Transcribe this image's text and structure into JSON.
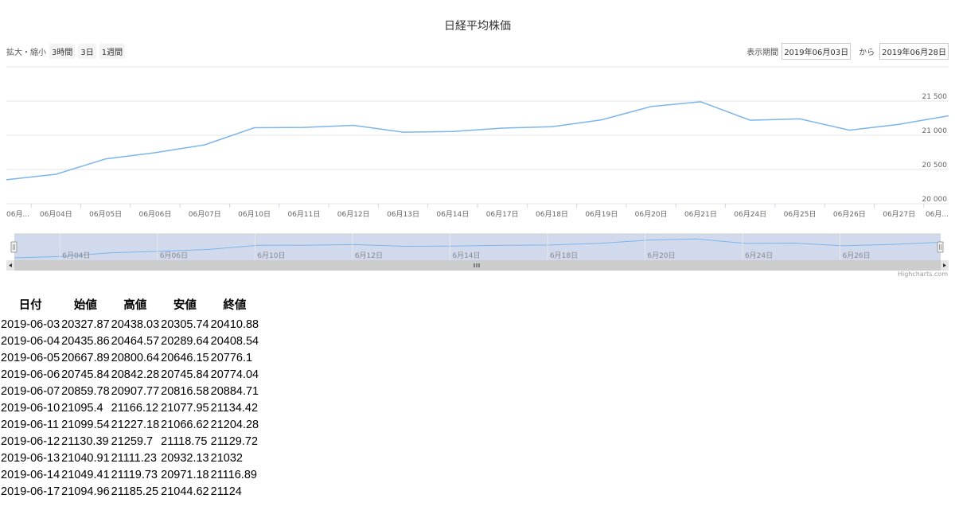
{
  "title": "日経平均株価",
  "zoom": {
    "label": "拡大・縮小",
    "buttons": [
      "3時間",
      "3日",
      "1週間"
    ]
  },
  "range": {
    "label": "表示期間",
    "from": "2019年06月03日",
    "to_label": "から",
    "to": "2019年06月28日"
  },
  "credit": "Highcharts.com",
  "chart_data": {
    "type": "line",
    "x": [
      "06月...",
      "06月04日",
      "06月05日",
      "06月06日",
      "06月07日",
      "06月10日",
      "06月11日",
      "06月12日",
      "06月13日",
      "06月14日",
      "06月17日",
      "06月18日",
      "06月19日",
      "06月20日",
      "06月21日",
      "06月24日",
      "06月25日",
      "06月26日",
      "06月27日",
      "06月..."
    ],
    "values": [
      20350,
      20430,
      20655,
      20745,
      20860,
      21110,
      21115,
      21145,
      21045,
      21055,
      21105,
      21125,
      21225,
      21420,
      21490,
      21220,
      21240,
      21075,
      21160,
      21285
    ],
    "y_ticks": [
      "20 000",
      "20 500",
      "21 000",
      "21 500"
    ],
    "y_tick_values": [
      20000,
      20500,
      21000,
      21500
    ],
    "ylim": [
      20000,
      22000
    ],
    "grid": true,
    "color": "#7cb5ec",
    "navigator": {
      "labels": [
        "6月04日",
        "6月06日",
        "6月10日",
        "6月12日",
        "6月14日",
        "6月18日",
        "6月20日",
        "6月24日",
        "6月26日"
      ],
      "label_index": [
        1,
        3,
        5,
        7,
        9,
        11,
        13,
        15,
        17
      ]
    }
  },
  "table": {
    "headers": [
      "日付",
      "始値",
      "高値",
      "安値",
      "終値"
    ],
    "rows": [
      [
        "2019-06-03",
        "20327.87",
        "20438.03",
        "20305.74",
        "20410.88"
      ],
      [
        "2019-06-04",
        "20435.86",
        "20464.57",
        "20289.64",
        "20408.54"
      ],
      [
        "2019-06-05",
        "20667.89",
        "20800.64",
        "20646.15",
        "20776.1"
      ],
      [
        "2019-06-06",
        "20745.84",
        "20842.28",
        "20745.84",
        "20774.04"
      ],
      [
        "2019-06-07",
        "20859.78",
        "20907.77",
        "20816.58",
        "20884.71"
      ],
      [
        "2019-06-10",
        "21095.4",
        "21166.12",
        "21077.95",
        "21134.42"
      ],
      [
        "2019-06-11",
        "21099.54",
        "21227.18",
        "21066.62",
        "21204.28"
      ],
      [
        "2019-06-12",
        "21130.39",
        "21259.7",
        "21118.75",
        "21129.72"
      ],
      [
        "2019-06-13",
        "21040.91",
        "21111.23",
        "20932.13",
        "21032"
      ],
      [
        "2019-06-14",
        "21049.41",
        "21119.73",
        "20971.18",
        "21116.89"
      ],
      [
        "2019-06-17",
        "21094.96",
        "21185.25",
        "21044.62",
        "21124"
      ]
    ]
  }
}
